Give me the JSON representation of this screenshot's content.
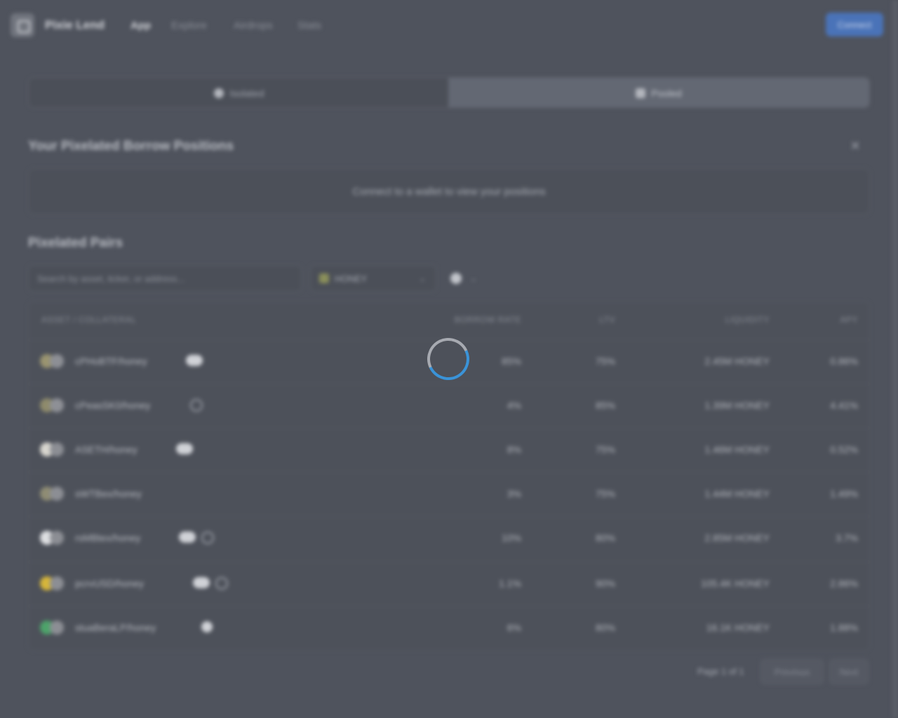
{
  "app": {
    "brand": "Pixie Lend"
  },
  "nav": [
    {
      "label": "App",
      "active": true
    },
    {
      "label": "Explore",
      "active": false
    },
    {
      "label": "Airdrops",
      "active": false
    },
    {
      "label": "Stats",
      "active": false
    }
  ],
  "header": {
    "connect_label": "Connect"
  },
  "mode_toggle": {
    "options": [
      "Isolated",
      "Pooled"
    ],
    "selected": "Pooled"
  },
  "positions": {
    "title": "Your Pixelated Borrow Positions",
    "empty_message": "Connect to a wallet to view your positions"
  },
  "pairs_section": {
    "title": "Pixelated Pairs",
    "search_placeholder": "Search by asset, ticker, or address...",
    "filter_label": "HONEY"
  },
  "table": {
    "columns": [
      "ASSET / COLLATERAL",
      "BORROW RATE",
      "LTV",
      "LIQUIDITY",
      "APY"
    ],
    "rows": [
      {
        "pair": "cPHoBTF/honey",
        "rate": "85%",
        "ltv": "75%",
        "liquidity": "2.45M HONEY",
        "apy": "0.86%",
        "token_colors": [
          "#9a9470",
          "#8d8f95"
        ],
        "badges": [
          "pill"
        ]
      },
      {
        "pair": "cPeasSK0/honey",
        "rate": "4%",
        "ltv": "85%",
        "liquidity": "1.39M HONEY",
        "apy": "4.41%",
        "token_colors": [
          "#8f8b6c",
          "#8e9096"
        ],
        "badges": [
          "round"
        ]
      },
      {
        "pair": "ASETH/honey",
        "rate": "8%",
        "ltv": "75%",
        "liquidity": "1.46M HONEY",
        "apy": "0.52%",
        "token_colors": [
          "#d8d6cf",
          "#8c8e94"
        ],
        "badges": [
          "pill"
        ]
      },
      {
        "pair": "sWTBex/honey",
        "rate": "3%",
        "ltv": "75%",
        "liquidity": "1.44M HONEY",
        "apy": "1.49%",
        "token_colors": [
          "#8f8c74",
          "#8c8e94"
        ],
        "badges": []
      },
      {
        "pair": "rsMBtex/honey",
        "rate": "10%",
        "ltv": "80%",
        "liquidity": "2.85M HONEY",
        "apy": "3.7%",
        "token_colors": [
          "#dedfe2",
          "#8c8e94"
        ],
        "badges": [
          "pill",
          "round"
        ]
      },
      {
        "pair": "pcrvUSD/honey",
        "rate": "1.1%",
        "ltv": "90%",
        "liquidity": "105.4K HONEY",
        "apy": "2.86%",
        "token_colors": [
          "#d6b53a",
          "#8c8e94"
        ],
        "badges": [
          "pill",
          "round"
        ]
      },
      {
        "pair": "stuaBeraLP/honey",
        "rate": "6%",
        "ltv": "80%",
        "liquidity": "16.1K HONEY",
        "apy": "1.88%",
        "token_colors": [
          "#4da36a",
          "#8c8e94"
        ],
        "badges": [
          "dot"
        ]
      }
    ]
  },
  "pagination": {
    "label": "Page 1 of 1",
    "prev_label": "Previous",
    "next_label": "Next"
  },
  "colors": {
    "background": "#4f535d",
    "accent": "#3a93d8",
    "connect_button": "#4a73b8"
  },
  "loading": true
}
